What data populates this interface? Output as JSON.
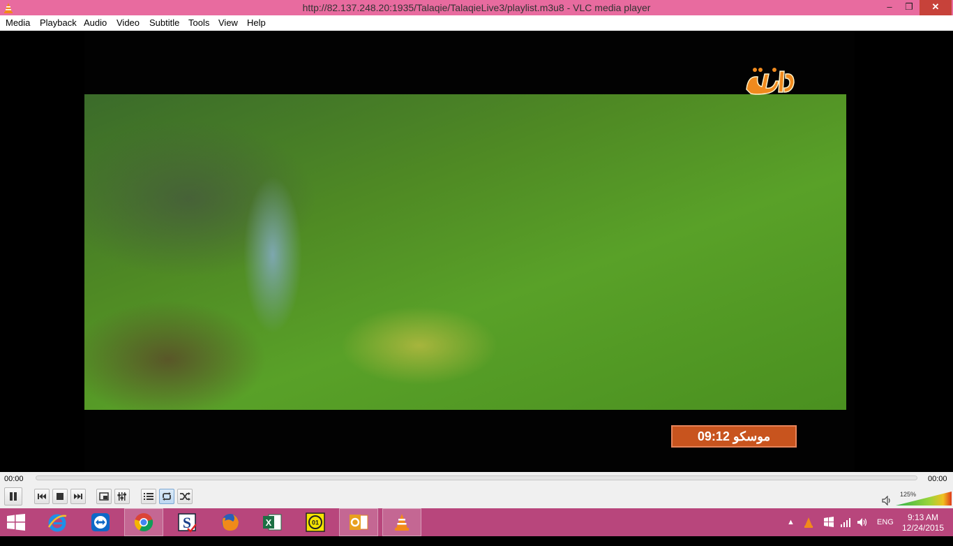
{
  "window": {
    "title": "http://82.137.248.20:1935/Talaqie/TalaqieLive3/playlist.m3u8 - VLC media player",
    "minimize": "‒",
    "maximize": "❐",
    "close": "✕"
  },
  "menu": [
    "Media",
    "Playback",
    "Audio",
    "Video",
    "Subtitle",
    "Tools",
    "View",
    "Help"
  ],
  "video": {
    "overlay_time": "09:12 موسكو",
    "channel_logo": "talaqie-logo"
  },
  "controls": {
    "time_elapsed": "00:00",
    "time_total": "00:00",
    "seek_position": 0,
    "volume_label": "125%",
    "volume_level_percent": 125,
    "buttons": [
      "pause-icon",
      "previous-icon",
      "stop-icon",
      "next-icon",
      "fullscreen-icon",
      "extended-settings-icon",
      "playlist-icon",
      "loop-icon",
      "shuffle-icon"
    ]
  },
  "taskbar": {
    "apps": [
      "internet-explorer-icon",
      "teamviewer-icon",
      "chrome-icon",
      "app-s-icon",
      "firefox-icon",
      "excel-icon",
      "app-clock-icon",
      "outlook-icon",
      "vlc-icon"
    ],
    "language": "ENG",
    "time": "9:13 AM",
    "date": "12/24/2015"
  },
  "colors": {
    "titlebar": "#e86b9f",
    "taskbar": "#b8467c",
    "clock_overlay": "#c8541e",
    "close_button": "#c7423a"
  }
}
